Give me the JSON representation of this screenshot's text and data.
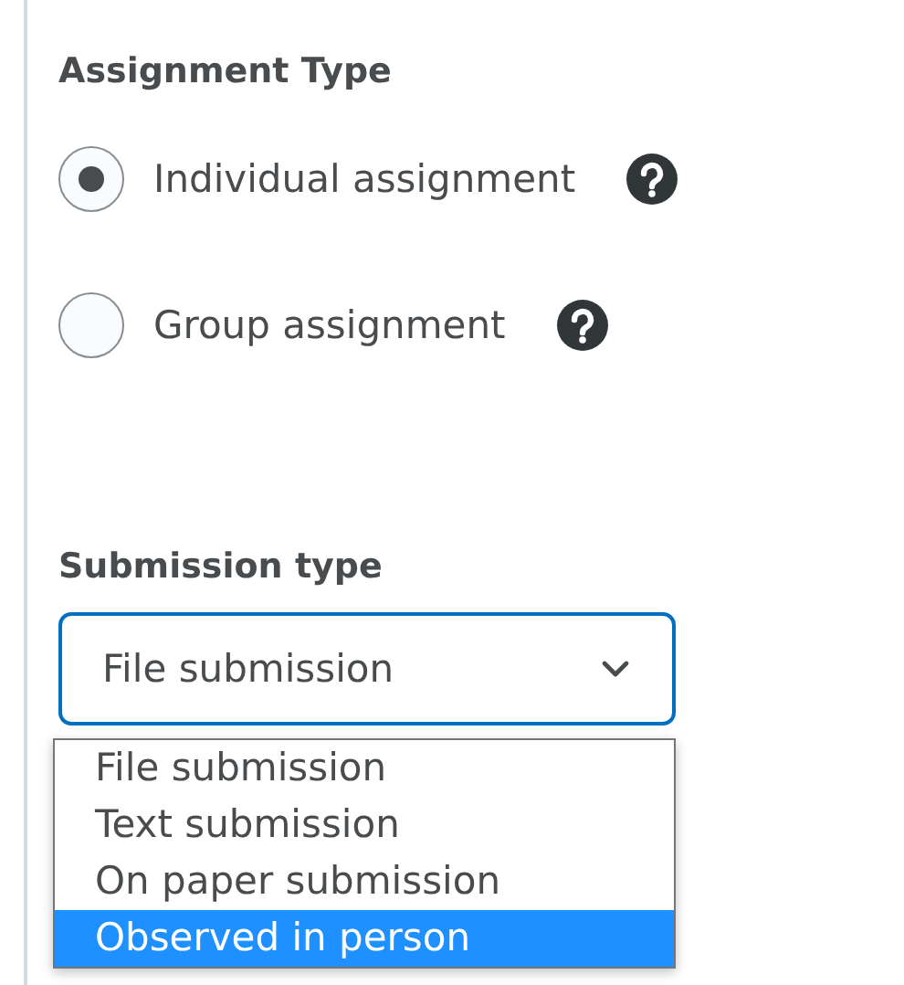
{
  "assignment_type": {
    "heading": "Assignment Type",
    "options": [
      {
        "label": "Individual assignment",
        "selected": true
      },
      {
        "label": "Group assignment",
        "selected": false
      }
    ]
  },
  "submission_type": {
    "heading": "Submission type",
    "value": "File submission",
    "expanded": true,
    "options": [
      {
        "label": "File submission",
        "highlighted": false
      },
      {
        "label": "Text submission",
        "highlighted": false
      },
      {
        "label": "On paper submission",
        "highlighted": false
      },
      {
        "label": "Observed in person",
        "highlighted": true
      }
    ]
  }
}
